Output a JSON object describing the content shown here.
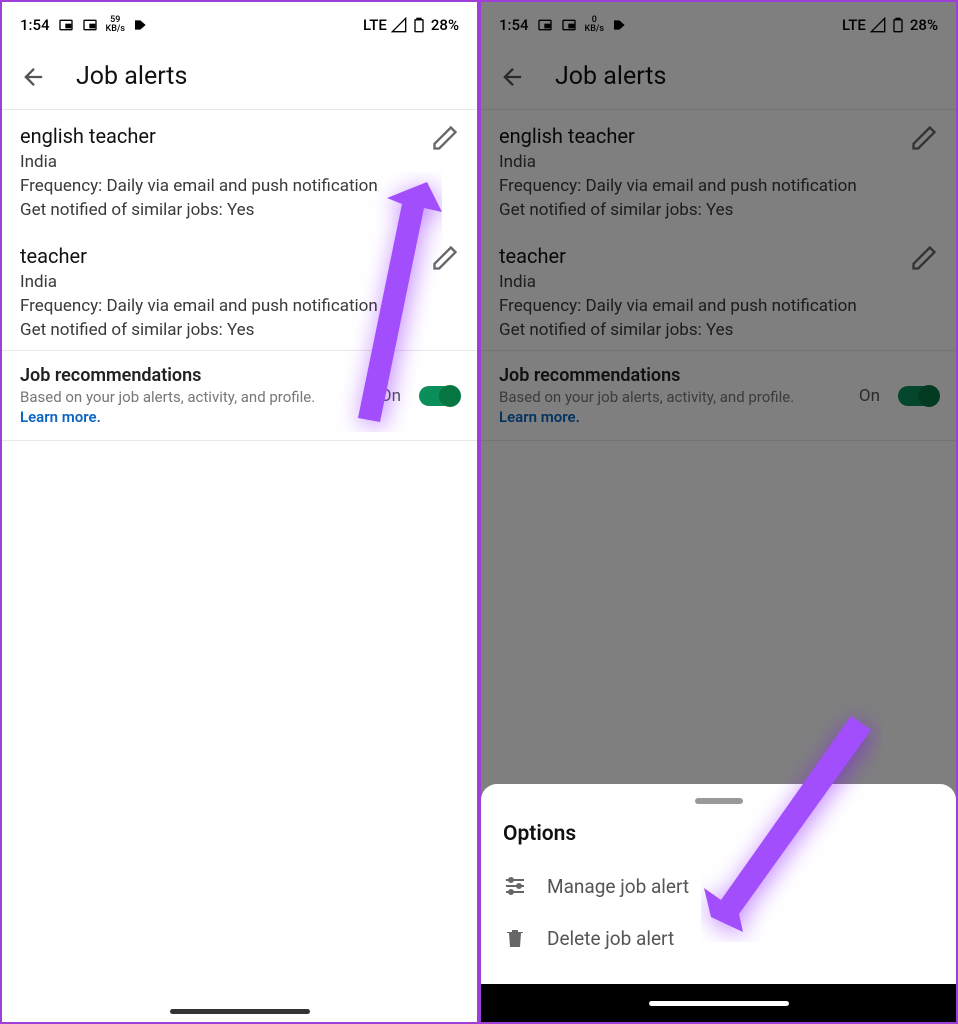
{
  "statusbar": {
    "time": "1:54",
    "speed_left": "59",
    "speed_left_unit": "KB/s",
    "speed_right": "0",
    "speed_right_unit": "KB/s",
    "network": "LTE",
    "battery": "28%"
  },
  "header": {
    "title": "Job alerts"
  },
  "alerts": [
    {
      "title": "english teacher",
      "location": "India",
      "frequency": "Frequency: Daily via email and push notification",
      "similar": "Get notified of similar jobs: Yes"
    },
    {
      "title": "teacher",
      "location": "India",
      "frequency": "Frequency: Daily via email and push notification",
      "similar": "Get notified of similar jobs: Yes"
    }
  ],
  "recommendations": {
    "title": "Job recommendations",
    "subtitle": "Based on your job alerts, activity, and profile.",
    "learn_more": "Learn more.",
    "state": "On"
  },
  "sheet": {
    "title": "Options",
    "manage": "Manage job alert",
    "delete": "Delete job alert"
  }
}
